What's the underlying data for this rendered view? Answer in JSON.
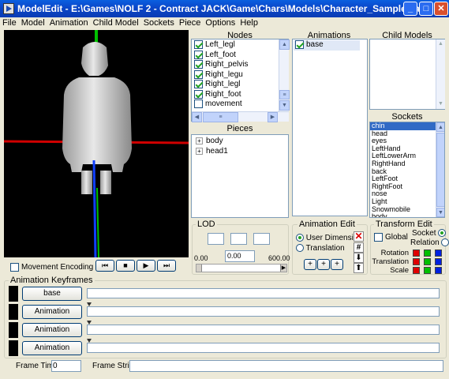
{
  "window": {
    "title": "ModelEdit - E:\\Games\\NOLF 2 - Contract JACK\\Game\\Chars\\Models\\Character_Sample.lta",
    "minimize": "_",
    "maximize": "□",
    "close": "✕"
  },
  "menu": [
    "File",
    "Model",
    "Animation",
    "Child Model",
    "Sockets",
    "Piece",
    "Options",
    "Help"
  ],
  "nodes": {
    "header": "Nodes",
    "items": [
      {
        "label": "Left_legl",
        "checked": true
      },
      {
        "label": "Left_foot",
        "checked": true
      },
      {
        "label": "Right_pelvis",
        "checked": true
      },
      {
        "label": "Right_legu",
        "checked": true
      },
      {
        "label": "Right_legl",
        "checked": true
      },
      {
        "label": "Right_foot",
        "checked": true
      },
      {
        "label": "movement",
        "checked": false
      }
    ]
  },
  "animations": {
    "header": "Animations",
    "items": [
      {
        "label": "base",
        "checked": true
      }
    ]
  },
  "child_models": {
    "header": "Child Models"
  },
  "pieces": {
    "header": "Pieces",
    "items": [
      "body",
      "head1"
    ]
  },
  "sockets": {
    "header": "Sockets",
    "items": [
      "chin",
      "head",
      "eyes",
      "LeftHand",
      "LeftLowerArm",
      "RightHand",
      "back",
      "LeftFoot",
      "RightFoot",
      "nose",
      "Light",
      "Snowmobile",
      "body"
    ],
    "selected": 0
  },
  "lod": {
    "title": "LOD",
    "min": "0.00",
    "current": "0.00",
    "max": "600.00",
    "slider_fraction": 0
  },
  "anim_edit": {
    "title": "Animation Edit",
    "user_dimension": "User Dimension",
    "translation": "Translation",
    "selected": "user_dimension",
    "plus": "+"
  },
  "transform_edit": {
    "title": "Transform Edit",
    "global": "Global",
    "socket": "Socket",
    "relation": "Relation",
    "rotation": "Rotation",
    "translation": "Translation",
    "scale": "Scale",
    "colors": [
      "#e00000",
      "#00c000",
      "#0020e0"
    ]
  },
  "movement_encoding": "Movement Encoding",
  "transport": [
    "⏮",
    "■",
    "▶",
    "⏭"
  ],
  "keyframes": {
    "title": "Animation Keyframes",
    "rows": [
      "base",
      "Animation",
      "Animation",
      "Animation"
    ]
  },
  "status": {
    "frame_time_label": "Frame Time:",
    "frame_time": "0",
    "frame_string_label": "Frame String:",
    "frame_string": ""
  }
}
